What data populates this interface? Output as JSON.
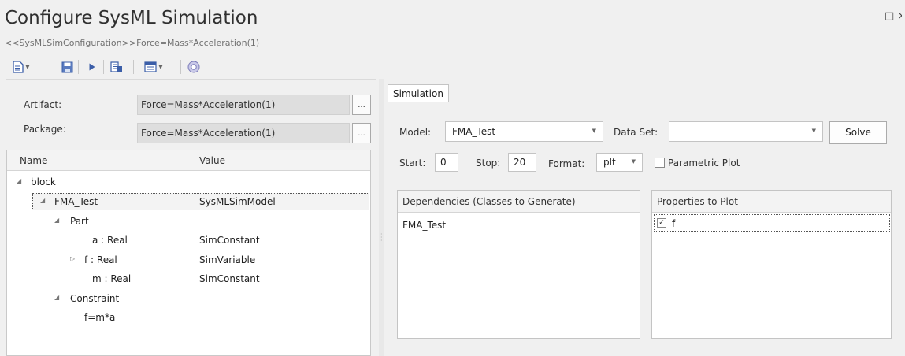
{
  "window": {
    "title": "Configure SysML Simulation",
    "subtitle": "<<SysMLSimConfiguration>>Force=Mass*Acceleration(1)",
    "controls": "□ ×"
  },
  "toolbar": {
    "items": [
      "new-document-icon",
      "save-icon",
      "run-icon",
      "generate-icon",
      "options-icon",
      "help-icon"
    ]
  },
  "artifact": {
    "label": "Artifact:",
    "value": "Force=Mass*Acceleration(1)",
    "button": "..."
  },
  "package": {
    "label": "Package:",
    "value": "Force=Mass*Acceleration(1)",
    "button": "..."
  },
  "tree": {
    "columns": {
      "name": "Name",
      "value": "Value"
    },
    "rows": [
      {
        "toggle": "◢",
        "name": "block",
        "value": ""
      },
      {
        "toggle": "◢",
        "name": "FMA_Test",
        "value": "SysMLSimModel"
      },
      {
        "toggle": "◢",
        "name": "Part",
        "value": ""
      },
      {
        "toggle": "",
        "name": "a : Real",
        "value": "SimConstant"
      },
      {
        "toggle": "▷",
        "name": "f : Real",
        "value": "SimVariable"
      },
      {
        "toggle": "",
        "name": "m : Real",
        "value": "SimConstant"
      },
      {
        "toggle": "◢",
        "name": "Constraint",
        "value": ""
      },
      {
        "toggle": "",
        "name": "f=m*a",
        "value": ""
      }
    ]
  },
  "simulation": {
    "tab": "Simulation",
    "model_label": "Model:",
    "model_value": "FMA_Test",
    "dataset_label": "Data Set:",
    "dataset_value": "",
    "solve": "Solve",
    "start_label": "Start:",
    "start_value": "0",
    "stop_label": "Stop:",
    "stop_value": "20",
    "format_label": "Format:",
    "format_value": "plt",
    "parametric_label": "Parametric Plot",
    "parametric_checked": false,
    "dependencies": {
      "header": "Dependencies (Classes to Generate)",
      "items": [
        "FMA_Test"
      ]
    },
    "properties": {
      "header": "Properties to Plot",
      "items": [
        {
          "name": "f",
          "checked": true
        }
      ]
    }
  }
}
